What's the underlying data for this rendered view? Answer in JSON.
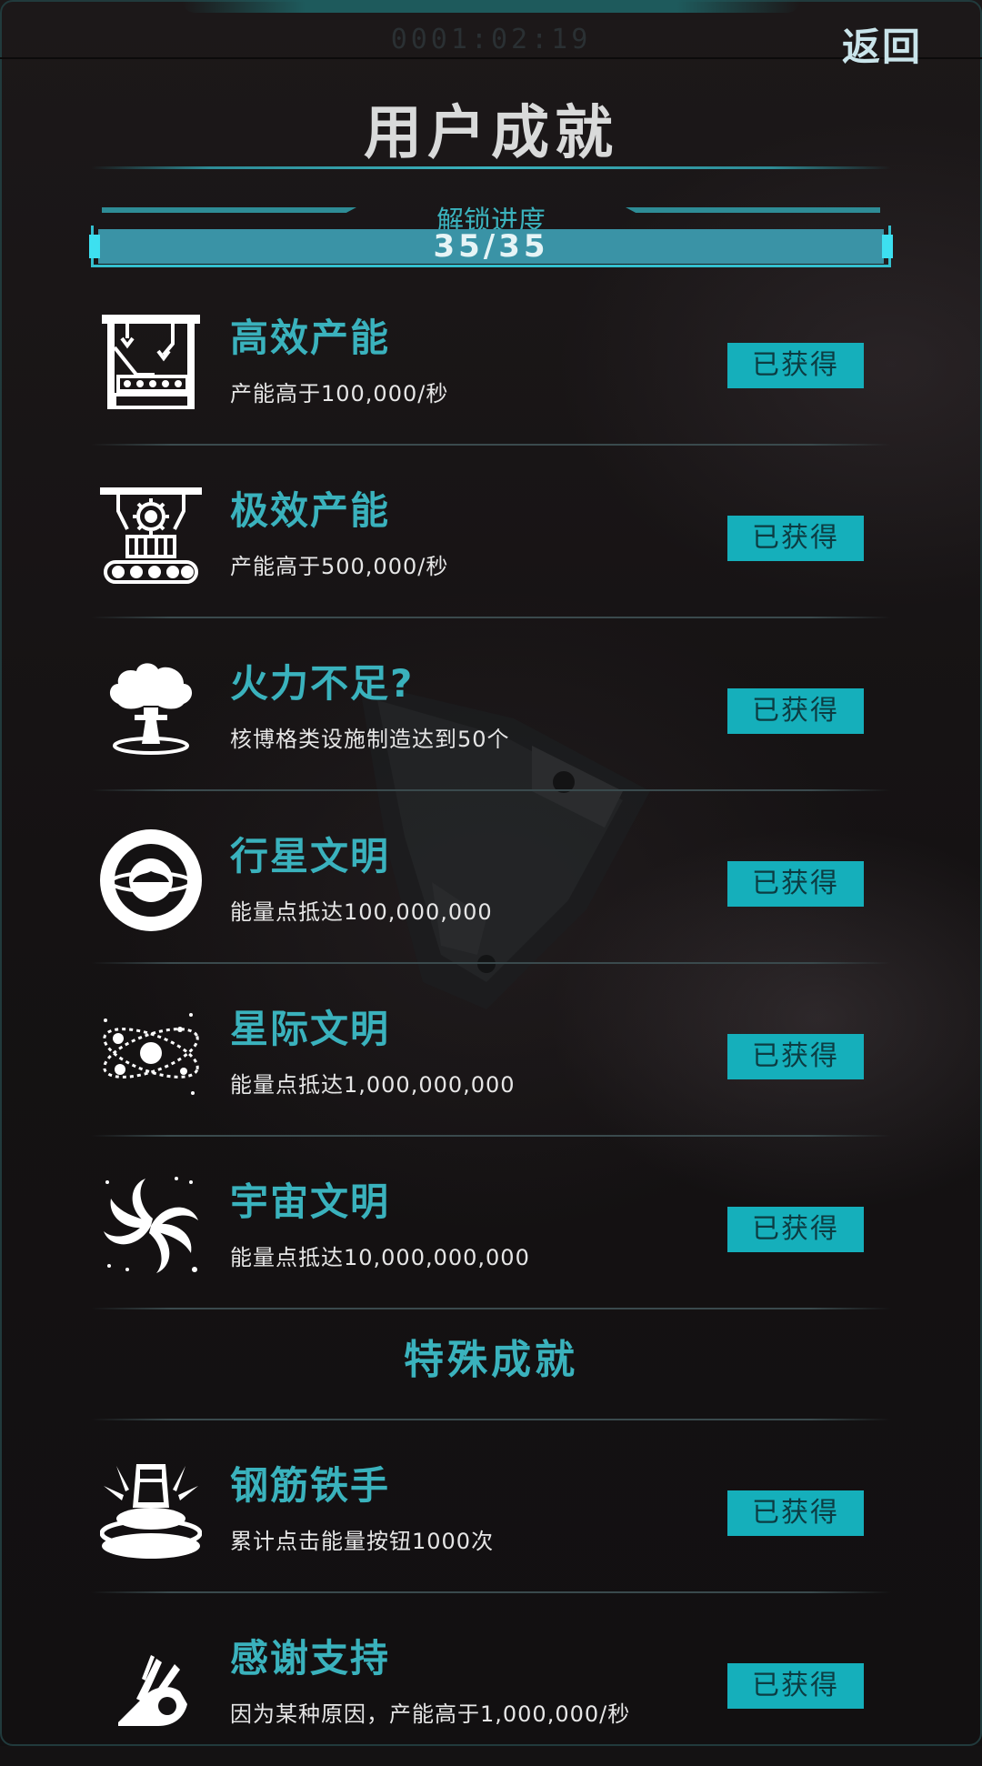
{
  "header": {
    "timer": "0001:02:19",
    "back_label": "返回",
    "title": "用户成就"
  },
  "progress": {
    "label": "解锁进度",
    "text": "35/35",
    "fraction": 1.0
  },
  "achievements": [
    {
      "name": "高效产能",
      "desc": "产能高于100,000/秒",
      "status": "已获得",
      "icon": "factory-robot-arm-icon"
    },
    {
      "name": "极效产能",
      "desc": "产能高于500,000/秒",
      "status": "已获得",
      "icon": "assembly-line-gear-icon"
    },
    {
      "name": "火力不足?",
      "desc": "核博格类设施制造达到50个",
      "status": "已获得",
      "icon": "mushroom-cloud-icon"
    },
    {
      "name": "行星文明",
      "desc": "能量点抵达100,000,000",
      "status": "已获得",
      "icon": "planet-icon"
    },
    {
      "name": "星际文明",
      "desc": "能量点抵达1,000,000,000",
      "status": "已获得",
      "icon": "solar-system-icon"
    },
    {
      "name": "宇宙文明",
      "desc": "能量点抵达10,000,000,000",
      "status": "已获得",
      "icon": "galaxy-spiral-icon"
    }
  ],
  "special_section": {
    "title": "特殊成就"
  },
  "special_achievements": [
    {
      "name": "钢筋铁手",
      "desc": "累计点击能量按钮1000次",
      "status": "已获得",
      "icon": "press-button-icon"
    },
    {
      "name": "感谢支持",
      "desc": "因为某种原因，产能高于1,000,000/秒",
      "status": "已获得",
      "icon": "hand-support-icon"
    }
  ],
  "colors": {
    "accent": "#3ab2bd",
    "badge": "#15afbb",
    "badge_text": "#0c3c42"
  }
}
